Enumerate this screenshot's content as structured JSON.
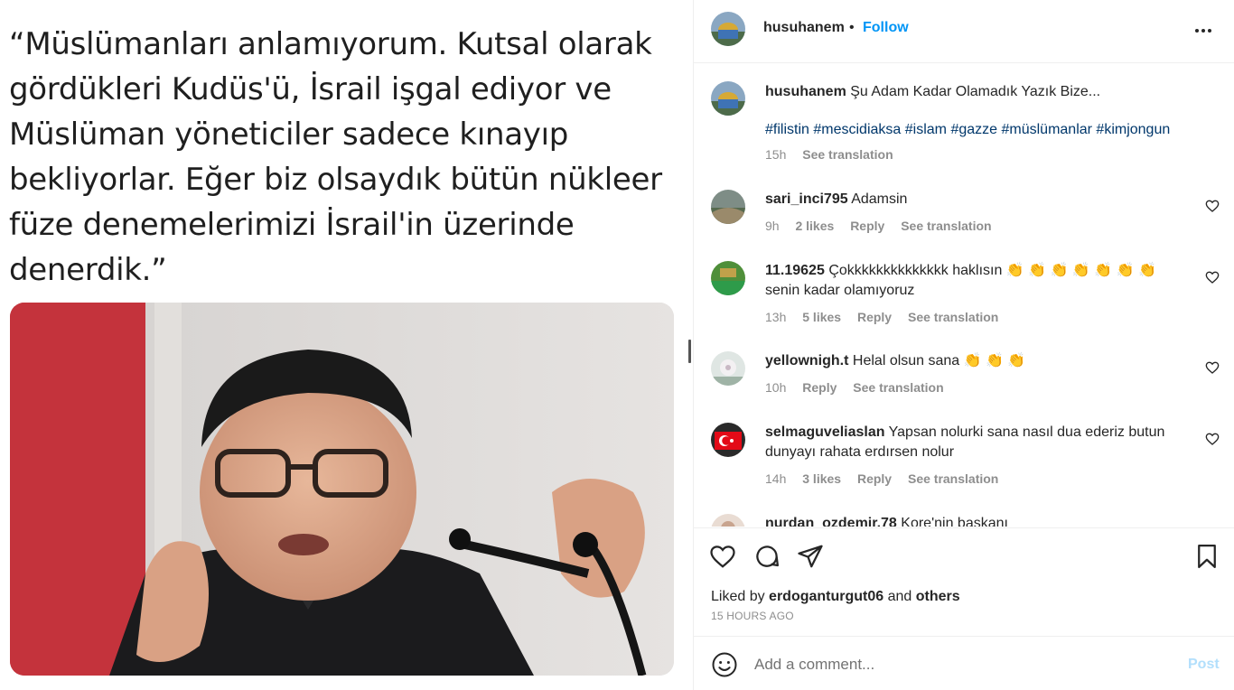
{
  "media": {
    "quote": "“Müslümanları anlamıyorum. Kutsal olarak gördükleri Kudüs'ü, İsrail işgal ediyor ve Müslüman yöneticiler sadece kınayıp bekliyorlar. Eğer biz olsaydık bütün nükleer füze denemelerimizi İsrail'in üzerinde denerdik.”"
  },
  "header": {
    "username": "husuhanem",
    "dot": "•",
    "follow_label": "Follow",
    "more_icon": "more-horizontal-icon"
  },
  "caption": {
    "username": "husuhanem",
    "text": "Şu Adam Kadar Olamadık Yazık Bize...",
    "hashtags": [
      "#filistin",
      "#mescidiaksa",
      "#islam",
      "#gazze",
      "#müslümanlar",
      "#kimjongun"
    ],
    "time": "15h",
    "see_translation": "See translation"
  },
  "comments": [
    {
      "username": "sari_inci795",
      "text": "Adamsin",
      "time": "9h",
      "likes": "2 likes",
      "reply": "Reply",
      "see_translation": "See translation"
    },
    {
      "username": "11.19625",
      "text": "Çokkkkkkkkkkkkkk haklısın 👏 👏 👏 👏 👏 👏 👏senin kadar olamıyoruz",
      "time": "13h",
      "likes": "5 likes",
      "reply": "Reply",
      "see_translation": "See translation"
    },
    {
      "username": "yellownigh.t",
      "text": "Helal olsun sana 👏 👏 👏",
      "time": "10h",
      "reply": "Reply",
      "see_translation": "See translation"
    },
    {
      "username": "selmaguveliaslan",
      "text": "Yapsan nolurki sana nasıl dua ederiz butun dunyayı rahata erdırsen nolur",
      "time": "14h",
      "likes": "3 likes",
      "reply": "Reply",
      "see_translation": "See translation"
    },
    {
      "username": "nurdan_ozdemir.78",
      "text": "Kore'nin başkanı"
    }
  ],
  "actions": {
    "like_icon": "heart-icon",
    "comment_icon": "comment-icon",
    "share_icon": "send-icon",
    "save_icon": "bookmark-icon",
    "liked_by_prefix": "Liked by",
    "liked_by_user": "erdoganturgut06",
    "liked_by_and": "and",
    "liked_by_others": "others",
    "timestamp": "15 HOURS AGO"
  },
  "add_comment": {
    "placeholder": "Add a comment...",
    "post_label": "Post",
    "emoji_icon": "smiley-icon"
  },
  "colors": {
    "accent": "#0095f6",
    "hashtag": "#00376b",
    "muted": "#8e8e8e",
    "post_disabled": "#b2dffc"
  }
}
